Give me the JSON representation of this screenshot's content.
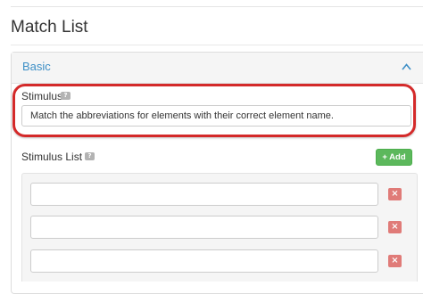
{
  "page": {
    "title": "Match List"
  },
  "panel": {
    "heading": "Basic",
    "collapse_icon": "chevron-up-icon"
  },
  "stimulus": {
    "label": "Stimulus",
    "help_icon": "?",
    "value": "Match the abbreviations for elements with their correct element name."
  },
  "stimulus_list": {
    "label": "Stimulus List",
    "help_icon": "?",
    "add_label": "+ Add",
    "remove_label": "×",
    "items": [
      {
        "value": ""
      },
      {
        "value": ""
      },
      {
        "value": ""
      }
    ]
  },
  "colors": {
    "accent": "#3d8fc6",
    "add_button": "#5cb85c",
    "remove_button": "#d9534f",
    "highlight": "#d42a2a"
  }
}
